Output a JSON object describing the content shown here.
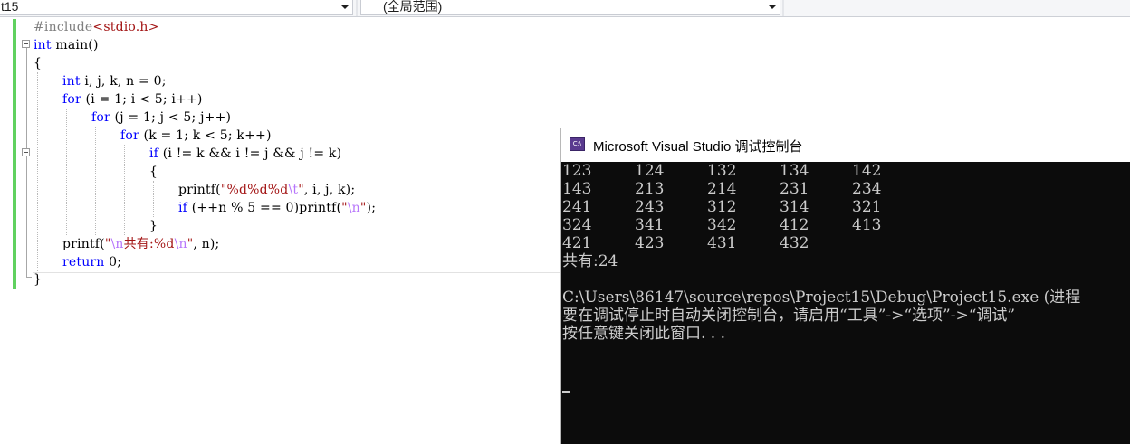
{
  "navbar": {
    "project_combo": "t15",
    "scope_combo": "(全局范围)"
  },
  "code": {
    "line1_pp": "#include",
    "line1_hdr": "<stdio.h>",
    "line2_kw": "int",
    "line2_rest": " main()",
    "line3": "{",
    "line4_kw": "int",
    "line4_rest": " i, j, k, n = 0;",
    "line5_kw": "for",
    "line5_rest": " (i = 1; i < 5; i++)",
    "line6_kw": "for",
    "line6_rest": " (j = 1; j < 5; j++)",
    "line7_kw": "for",
    "line7_rest": " (k = 1; k < 5; k++)",
    "line8_kw": "if",
    "line8_rest": " (i != k && i != j && j != k)",
    "line9": "{",
    "line10_a": "printf(",
    "line10_str1": "\"%d%d%d",
    "line10_esc": "\\t",
    "line10_str2": "\"",
    "line10_b": ", i, j, k);",
    "line11_kw": "if",
    "line11_a": " (++n % 5 == 0)printf(",
    "line11_str1": "\"",
    "line11_esc": "\\n",
    "line11_str2": "\"",
    "line11_b": ");",
    "line12": "}",
    "line13_a": "printf(",
    "line13_str1": "\"",
    "line13_esc1": "\\n",
    "line13_str2": "共有:%d",
    "line13_esc2": "\\n",
    "line13_str3": "\"",
    "line13_b": ", n);",
    "line14_kw": "return",
    "line14_rest": " 0;",
    "line15": "}"
  },
  "console": {
    "title": "Microsoft Visual Studio 调试控制台",
    "icon_text": "C:\\",
    "rows": [
      [
        "123",
        "124",
        "132",
        "134",
        "142"
      ],
      [
        "143",
        "213",
        "214",
        "231",
        "234"
      ],
      [
        "241",
        "243",
        "312",
        "314",
        "321"
      ],
      [
        "324",
        "341",
        "342",
        "412",
        "413"
      ],
      [
        "421",
        "423",
        "431",
        "432"
      ]
    ],
    "total_line": "共有:24",
    "exit_line": "C:\\Users\\86147\\source\\repos\\Project15\\Debug\\Project15.exe (进程",
    "hint_line": "要在调试停止时自动关闭控制台，请启用“工具”->“选项”->“调试”",
    "press_line": "按任意键关闭此窗口. . ."
  },
  "colors": {
    "keyword": "#0000ff",
    "string": "#a31515",
    "escape": "#b776fb",
    "preprocessor": "#808080",
    "change_bar": "#60d15f",
    "console_bg": "#0c0c0c",
    "console_text": "#cccccc"
  },
  "icons": [
    "dropdown-arrow-icon",
    "console-app-icon",
    "fold-collapse-icon"
  ]
}
